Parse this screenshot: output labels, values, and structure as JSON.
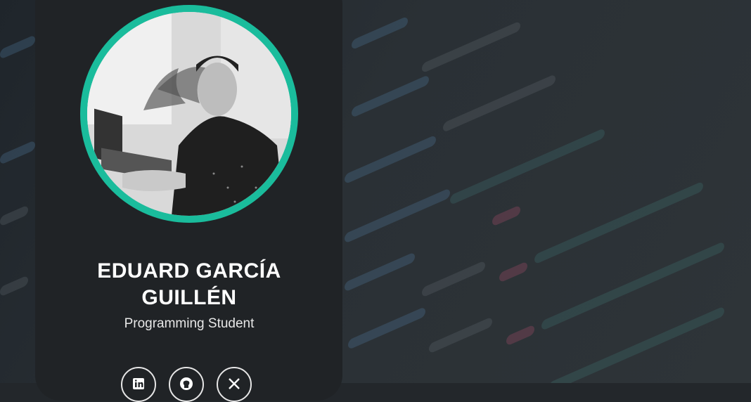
{
  "profile": {
    "name": "EDUARD GARCÍA GUILLÉN",
    "title": "Programming Student",
    "photo_alt": "Profile photo"
  },
  "socials": [
    {
      "name": "linkedin",
      "icon": "linkedin-icon"
    },
    {
      "name": "github",
      "icon": "github-icon"
    },
    {
      "name": "x",
      "icon": "x-icon"
    }
  ],
  "colors": {
    "accent": "#1abc9c",
    "card": "#202326",
    "background": "#23272b"
  }
}
